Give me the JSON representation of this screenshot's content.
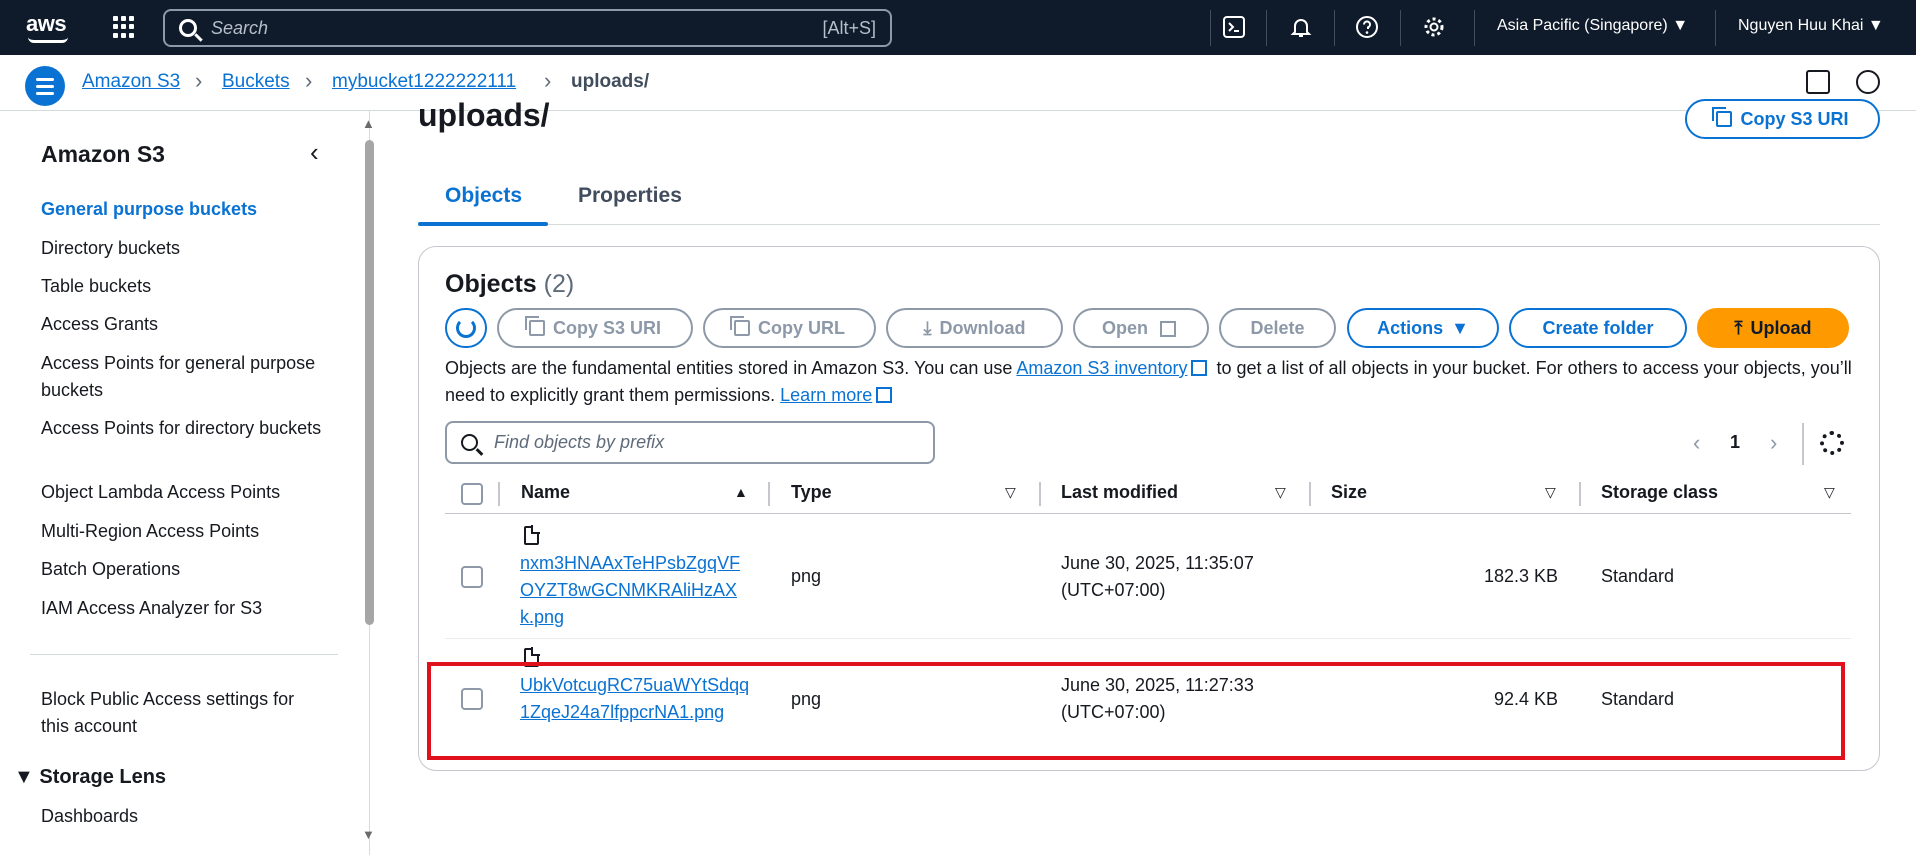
{
  "topnav": {
    "logo": "aws",
    "search_placeholder": "Search",
    "search_shortcut": "[Alt+S]",
    "region": "Asia Pacific (Singapore) ▼",
    "user": "Nguyen Huu Khai ▼",
    "icons": [
      "cloudshell-icon",
      "bell-icon",
      "help-icon",
      "gear-icon"
    ]
  },
  "breadcrumb": {
    "items": [
      "Amazon S3",
      "Buckets",
      "mybucket1222222111"
    ],
    "current": "uploads/"
  },
  "sidebar": {
    "title": "Amazon S3",
    "items": [
      "General purpose buckets",
      "Directory buckets",
      "Table buckets",
      "Access Grants",
      "Access Points for general purpose buckets",
      "Access Points for directory buckets",
      "Object Lambda Access Points",
      "Multi-Region Access Points",
      "Batch Operations",
      "IAM Access Analyzer for S3"
    ],
    "block_public": "Block Public Access settings for this account",
    "section": "Storage Lens",
    "section_items": [
      "Dashboards"
    ]
  },
  "main": {
    "title": "uploads/",
    "copy_s3_uri_top": "Copy S3 URI",
    "tabs": [
      "Objects",
      "Properties"
    ],
    "panel_title": "Objects",
    "panel_count": "(2)",
    "buttons": {
      "copy_s3_uri": "Copy S3 URI",
      "copy_url": "Copy URL",
      "download": "Download",
      "open": "Open",
      "delete": "Delete",
      "actions": "Actions",
      "create_folder": "Create folder",
      "upload": "Upload"
    },
    "desc_1": "Objects are the fundamental entities stored in Amazon S3. You can use ",
    "desc_link_1": "Amazon S3 inventory",
    "desc_2": " to get a list of all objects in your bucket. For others to access your objects, you’ll need to explicitly grant them permissions. ",
    "desc_link_2": "Learn more",
    "filter_placeholder": "Find objects by prefix",
    "page": "1",
    "columns": [
      "Name",
      "Type",
      "Last modified",
      "Size",
      "Storage class"
    ],
    "rows": [
      {
        "name": "nxm3HNAAxTeHPsbZgqVFOYZT8wGCNMKRAliHzAXk.png",
        "type": "png",
        "modified": "June 30, 2025, 11:35:07 (UTC+07:00)",
        "size": "182.3 KB",
        "storage": "Standard"
      },
      {
        "name": "UbkVotcugRC75uaWYtSdqq1ZqeJ24a7lfppcrNA1.png",
        "type": "png",
        "modified": "June 30, 2025, 11:27:33 (UTC+07:00)",
        "size": "92.4 KB",
        "storage": "Standard"
      }
    ]
  },
  "colors": {
    "nav_bg": "#0f1b2a",
    "link": "#0972d3",
    "upload": "#ff9900",
    "highlight": "#e0101c"
  }
}
